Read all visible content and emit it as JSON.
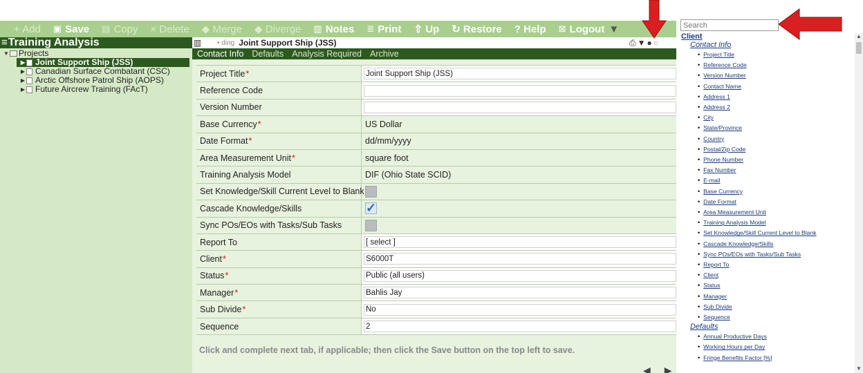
{
  "toolbar": {
    "add": "+ Add",
    "save": "Save",
    "copy": "Copy",
    "delete": "× Delete",
    "merge": "◆ Merge",
    "diverge": "◆ Diverge",
    "notes": "Notes",
    "print": "Print",
    "up": "⇧ Up",
    "restore": "↻ Restore",
    "help": "? Help",
    "logout": "Logout"
  },
  "left_panel": {
    "title": "Training Analysis",
    "root": "Projects",
    "items": [
      {
        "label": "Joint Support Ship (JSS)",
        "selected": true
      },
      {
        "label": "Canadian Surface Combatant (CSC)"
      },
      {
        "label": "Arctic Offshore Patrol Ship (AOPS)"
      },
      {
        "label": "Future Aircrew Training (FAcT)"
      }
    ]
  },
  "main_header": {
    "crumb": "• ding",
    "title": "Joint Support Ship (JSS)"
  },
  "tabs": [
    "Contact Info",
    "Defaults",
    "Analysis Required",
    "Archive"
  ],
  "form": {
    "rows": [
      {
        "label": "Project Title",
        "required": true,
        "value": "Joint Support Ship (JSS)",
        "kind": "input"
      },
      {
        "label": "Reference Code",
        "required": false,
        "value": "",
        "kind": "input"
      },
      {
        "label": "Version Number",
        "required": false,
        "value": "",
        "kind": "input"
      },
      {
        "label": "Base Currency",
        "required": true,
        "value": "US Dollar",
        "kind": "text"
      },
      {
        "label": "Date Format",
        "required": true,
        "value": "dd/mm/yyyy",
        "kind": "text"
      },
      {
        "label": "Area Measurement Unit",
        "required": true,
        "value": "square foot",
        "kind": "text"
      },
      {
        "label": "Training Analysis Model",
        "required": false,
        "value": "DIF (Ohio State SCID)",
        "kind": "text"
      },
      {
        "label": "Set Knowledge/Skill Current Level to Blank",
        "required": false,
        "value": "",
        "kind": "checkbox",
        "checked": false
      },
      {
        "label": "Cascade Knowledge/Skills",
        "required": false,
        "value": "",
        "kind": "checkbox",
        "checked": true
      },
      {
        "label": "Sync POs/EOs with Tasks/Sub Tasks",
        "required": false,
        "value": "",
        "kind": "checkbox",
        "checked": false
      },
      {
        "label": "Report To",
        "required": false,
        "value": "[ select ]",
        "kind": "input"
      },
      {
        "label": "Client",
        "required": true,
        "value": "S6000T",
        "kind": "input"
      },
      {
        "label": "Status",
        "required": true,
        "value": "Public (all users)",
        "kind": "input"
      },
      {
        "label": "Manager",
        "required": true,
        "value": "Bahlis Jay",
        "kind": "input"
      },
      {
        "label": "Sub Divide",
        "required": true,
        "value": "No",
        "kind": "input"
      },
      {
        "label": "Sequence",
        "required": false,
        "value": "2",
        "kind": "input"
      }
    ],
    "hint": "Click and complete next tab, if applicable; then click the Save button on the top left to save."
  },
  "search": {
    "placeholder": "Search"
  },
  "index": {
    "client": "Client",
    "contact_info": "Contact Info",
    "contact_items": [
      "Project Title",
      "Reference Code",
      "Version Number",
      "Contact Name",
      "Address 1",
      "Address 2",
      "City",
      "State/Province",
      "Country",
      "Postal/Zip Code",
      "Phone Number",
      "Fax Number",
      "E-mail",
      "Base Currency",
      "Date Format",
      "Area Measurement Unit",
      "Training Analysis Model",
      "Set Knowledge/Skill Current Level to Blank",
      "Cascade Knowledge/Skills",
      "Sync POs/EOs with Tasks/Sub Tasks",
      "Report To",
      "Client",
      "Status",
      "Manager",
      "Sub Divide",
      "Sequence"
    ],
    "defaults": "Defaults",
    "default_items": [
      "Annual Productive Days",
      "Working Hours per Day",
      "Fringe Benefits Factor [%]"
    ]
  },
  "colors": {
    "toolbar_bg": "#a8cf8e",
    "dark_green": "#2c5a1e",
    "panel_green": "#d6e9c6",
    "arrow_red": "#d91f1f"
  }
}
